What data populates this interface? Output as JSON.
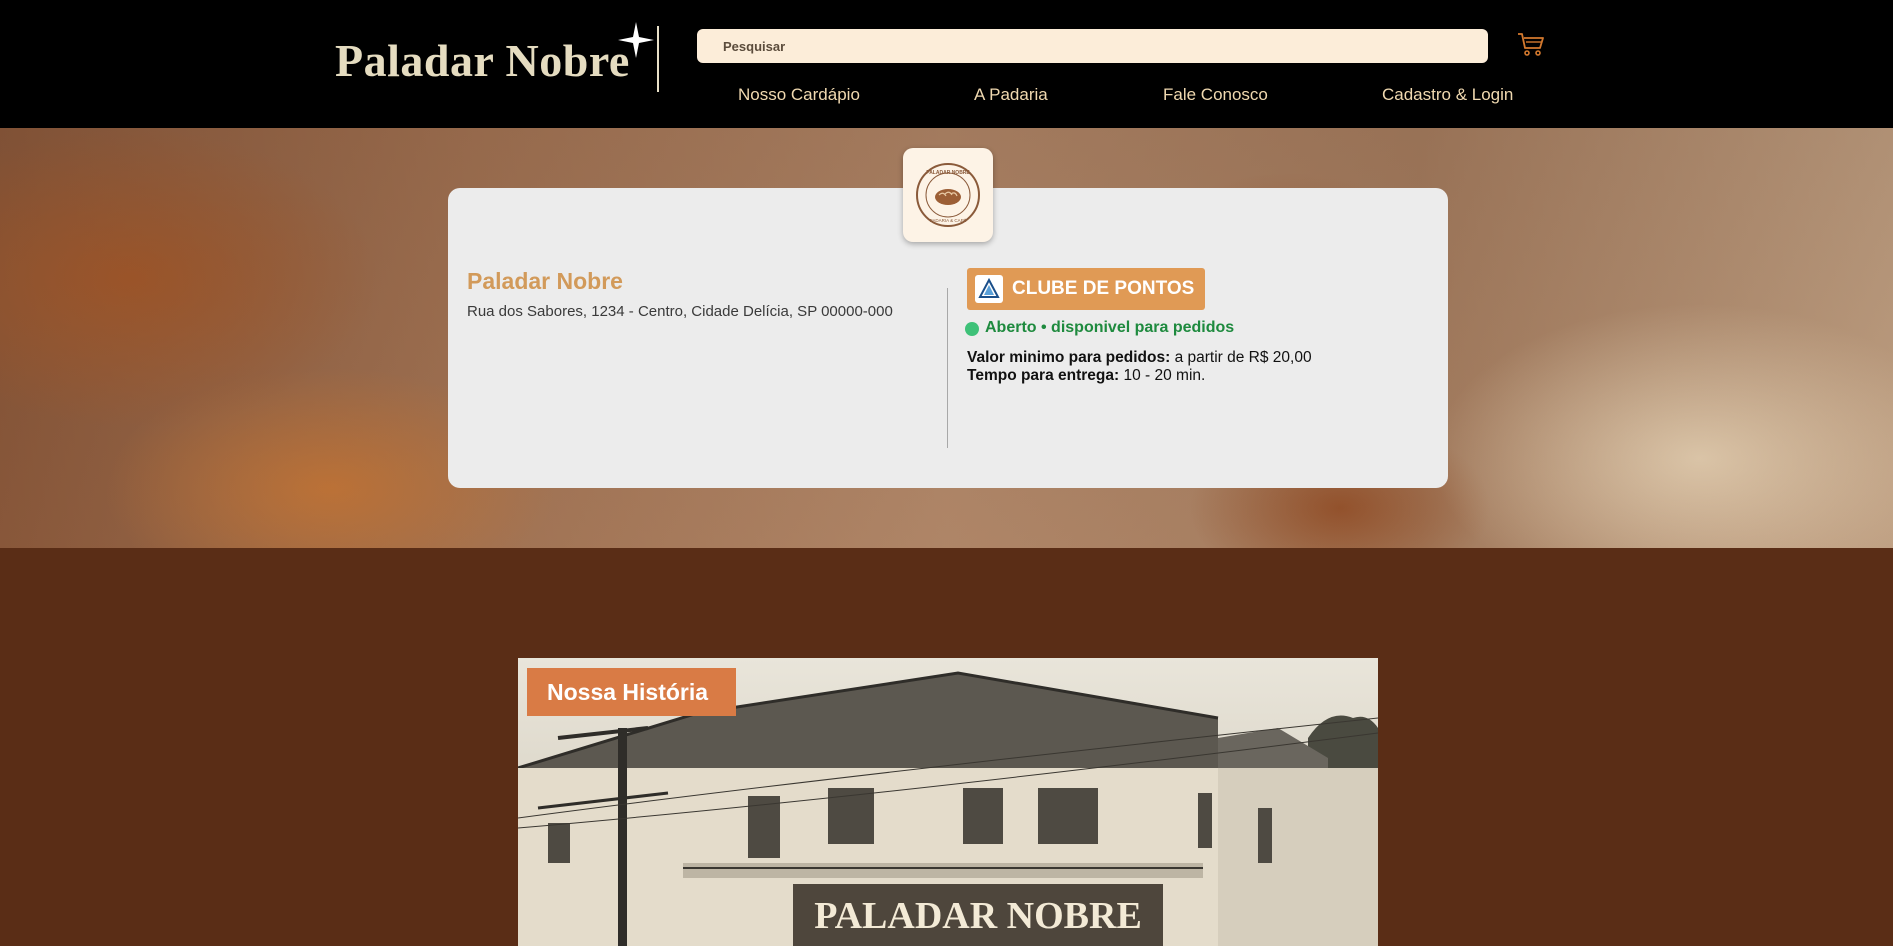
{
  "header": {
    "logo_text": "Paladar Nobre",
    "search_placeholder": "Pesquisar",
    "cart_icon": "cart-icon",
    "nav": [
      "Nosso Cardápio",
      "A Padaria",
      "Fale Conosco",
      "Cadastro & Login"
    ]
  },
  "store": {
    "badge_icon": "bakery-seal-logo",
    "badge_text_top": "PALADAR NOBRE",
    "badge_text_bottom": "PADARIA & CAFÉ",
    "name": "Paladar Nobre",
    "address": "Rua dos Sabores, 1234 - Centro, Cidade Delícia, SP 00000-000",
    "points_club_label": "CLUBE DE PONTOS",
    "points_club_icon": "triangle-logo-icon",
    "status": "Aberto • disponivel para pedidos",
    "min_order_label": "Valor minimo para pedidos:",
    "min_order_value": "a partir de R$ 20,00",
    "delivery_time_label": "Tempo para entrega:",
    "delivery_time_value": "10 - 20 min."
  },
  "history": {
    "title": "Nossa História",
    "sign_text": "PALADAR NOBRE"
  },
  "colors": {
    "header_bg": "#000000",
    "page_bg": "#5a2d16",
    "accent_orange": "#e09a55",
    "status_green": "#3ec178",
    "store_name": "#d29a5a"
  }
}
